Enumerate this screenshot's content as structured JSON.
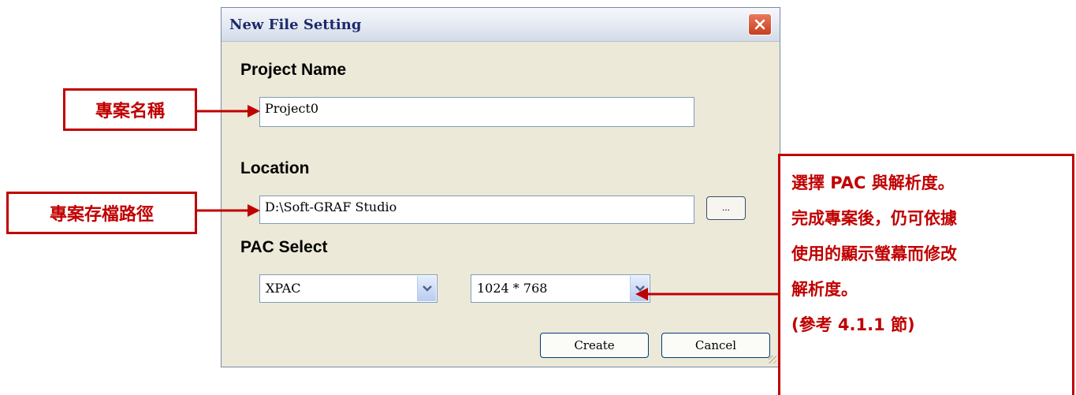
{
  "dialog": {
    "title": "New File Setting",
    "project_name_label": "Project Name",
    "project_name_value": "Project0",
    "location_label": "Location",
    "location_value": "D:\\Soft-GRAF Studio",
    "browse_label": "...",
    "pac_select_label": "PAC Select",
    "pac_value": "XPAC",
    "resolution_value": "1024 * 768",
    "create_label": "Create",
    "cancel_label": "Cancel"
  },
  "annotations": {
    "project_name_note": "專案名稱",
    "location_note": "專案存檔路徑",
    "pac_note_lines": [
      "選擇 PAC 與解析度。",
      "完成專案後，仍可依據",
      "使用的顯示螢幕而修改",
      "解析度。",
      "(參考 4.1.1 節)"
    ],
    "accent_color": "#c00000"
  },
  "icons": {
    "close": "close-x-icon",
    "dropdown": "chevron-down-icon"
  }
}
